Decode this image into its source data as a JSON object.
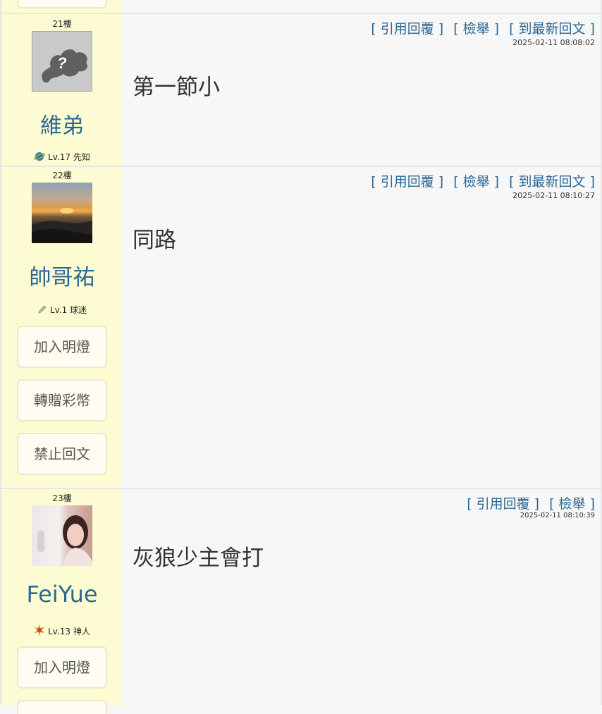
{
  "posts": [
    {
      "floor": "21樓",
      "username": "維弟",
      "level": "Lv.17 先知",
      "level_icon": "planet-icon",
      "actions": [
        "[ 引用回覆 ]",
        "[ 檢舉 ]",
        "[ 到最新回文 ]"
      ],
      "timestamp": "2025-02-11 08:08:02",
      "content": "第一節小",
      "side_buttons": []
    },
    {
      "floor": "22樓",
      "username": "帥哥祐",
      "level": "Lv.1 球迷",
      "level_icon": "pencil-icon",
      "actions": [
        "[ 引用回覆 ]",
        "[ 檢舉 ]",
        "[ 到最新回文 ]"
      ],
      "timestamp": "2025-02-11 08:10:27",
      "content": "同路",
      "side_buttons": [
        "加入明燈",
        "轉贈彩幣",
        "禁止回文"
      ]
    },
    {
      "floor": "23樓",
      "username": "FeiYue",
      "level": "Lv.13 神人",
      "level_icon": "star-burst-icon",
      "actions": [
        "[ 引用回覆 ]",
        "[ 檢舉 ]"
      ],
      "timestamp": "2025-02-11 08:10:39",
      "content": "灰狼少主會打",
      "side_buttons": [
        "加入明燈"
      ]
    }
  ],
  "colors": {
    "accent": "#2c6794",
    "sidebar_bg": "#fdfbd2",
    "page_bg": "#f7f7f7"
  }
}
